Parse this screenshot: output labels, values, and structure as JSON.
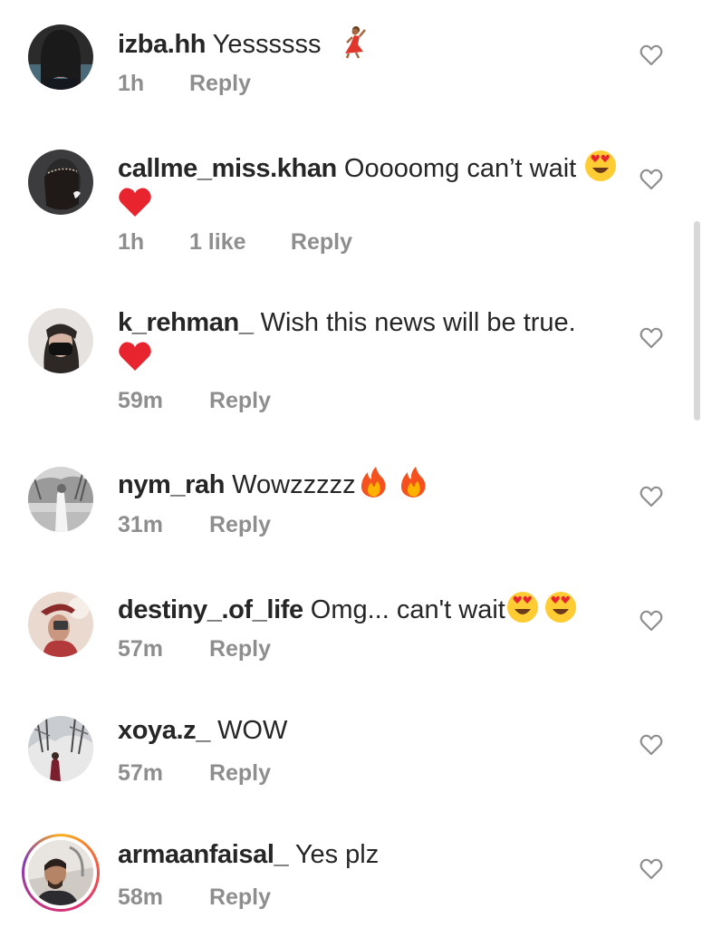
{
  "comments": [
    {
      "username": "izba.hh",
      "text": "Yessssss",
      "time": "1h",
      "likes": "",
      "reply": "Reply",
      "emoji": [
        "dancer-emoji"
      ]
    },
    {
      "username": "callme_miss.khan",
      "text": "Ooooomg can’t wait",
      "time": "1h",
      "likes": "1 like",
      "reply": "Reply",
      "emoji": [
        "heart-eyes-emoji",
        "red-heart-emoji"
      ]
    },
    {
      "username": "k_rehman_",
      "text": "Wish this news will be true.",
      "time": "59m",
      "likes": "",
      "reply": "Reply",
      "emoji": [
        "red-heart-emoji"
      ]
    },
    {
      "username": "nym_rah",
      "text": "Wowzzzzz",
      "time": "31m",
      "likes": "",
      "reply": "Reply",
      "emoji": [
        "fire-emoji",
        "fire-emoji"
      ]
    },
    {
      "username": "destiny_.of_life",
      "text": "Omg... can't wait",
      "time": "57m",
      "likes": "",
      "reply": "Reply",
      "emoji": [
        "heart-eyes-emoji",
        "heart-eyes-emoji"
      ]
    },
    {
      "username": "xoya.z_",
      "text": "WOW",
      "time": "57m",
      "likes": "",
      "reply": "Reply",
      "emoji": []
    },
    {
      "username": "armaanfaisal_",
      "text": "Yes plz",
      "time": "58m",
      "likes": "",
      "reply": "Reply",
      "emoji": []
    }
  ],
  "colors": {
    "text": "#262626",
    "meta": "#8e8e8e",
    "heart_outline": "#8e8e8e",
    "red_heart": "#e8242f"
  },
  "icons": {
    "like": "heart-outline-icon"
  }
}
